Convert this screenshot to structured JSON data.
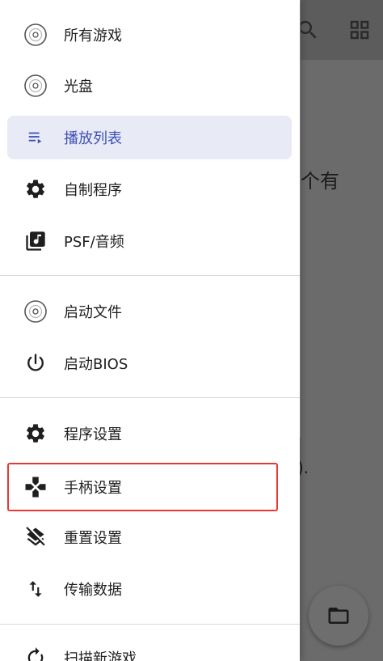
{
  "background": {
    "text_line_1": "个有",
    "text_line_2": ")",
    "text_line_3": ").",
    "icons": [
      "search-icon",
      "grid-view-icon",
      "folder-icon"
    ]
  },
  "drawer": {
    "sections": [
      {
        "items": [
          {
            "label": "所有游戏",
            "icon": "disc-icon"
          },
          {
            "label": "光盘",
            "icon": "disc-icon"
          },
          {
            "label": "播放列表",
            "icon": "playlist-icon",
            "active": true
          },
          {
            "label": "自制程序",
            "icon": "gear-icon"
          },
          {
            "label": "PSF/音频",
            "icon": "music-library-icon"
          }
        ]
      },
      {
        "items": [
          {
            "label": "启动文件",
            "icon": "disc-icon"
          },
          {
            "label": "启动BIOS",
            "icon": "power-icon"
          }
        ]
      },
      {
        "items": [
          {
            "label": "程序设置",
            "icon": "gear-icon"
          },
          {
            "label": "手柄设置",
            "icon": "gamepad-icon",
            "highlighted": true
          },
          {
            "label": "重置设置",
            "icon": "layers-clear-icon"
          },
          {
            "label": "传输数据",
            "icon": "swap-vert-icon"
          }
        ]
      },
      {
        "items": [
          {
            "label": "扫描新游戏",
            "icon": "refresh-icon"
          }
        ]
      }
    ]
  },
  "colors": {
    "active_bg": "#e8eaf6",
    "active_text": "#3f51b5",
    "highlight_border": "#e53935",
    "scrim": "#6b6b6b"
  }
}
